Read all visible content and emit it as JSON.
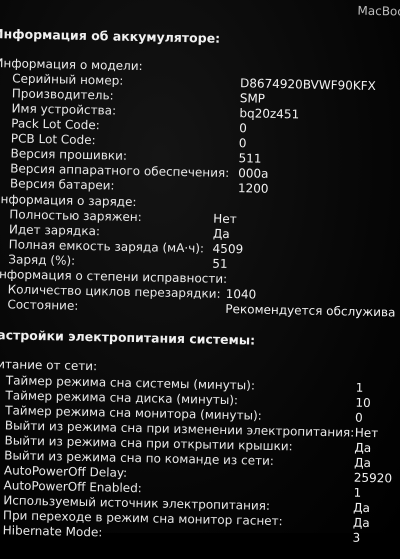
{
  "corner_text": "MacBook",
  "battery_section": {
    "title": "Информация об аккумуляторе:",
    "model_info": {
      "title": "Информация о модели:",
      "rows": [
        {
          "label": "Серийный номер:",
          "value": "D8674920BVWF90KFX"
        },
        {
          "label": "Производитель:",
          "value": "SMP"
        },
        {
          "label": "Имя устройства:",
          "value": "bq20z451"
        },
        {
          "label": "Pack Lot Code:",
          "value": "0"
        },
        {
          "label": "PCB Lot Code:",
          "value": "0"
        },
        {
          "label": "Версия прошивки:",
          "value": "511"
        },
        {
          "label": "Версия аппаратного обеспечения:",
          "value": "000a"
        },
        {
          "label": "Версия батареи:",
          "value": "1200"
        }
      ]
    },
    "charge_info": {
      "title": "Информация о заряде:",
      "rows": [
        {
          "label": "Полностью заряжен:",
          "value": "Нет"
        },
        {
          "label": "Идет зарядка:",
          "value": "Да"
        },
        {
          "label": "Полная емкость заряда (мА·ч):",
          "value": "4509"
        },
        {
          "label": "Заряд (%):",
          "value": "51"
        }
      ]
    },
    "health_info": {
      "title": "Информация о степени исправности:",
      "rows": [
        {
          "label": "Количество циклов перезарядки:",
          "value": "1040"
        },
        {
          "label": "Состояние:",
          "value": "Рекомендуется обслужива"
        }
      ]
    }
  },
  "power_section": {
    "title": "Настройки электропитания системы:",
    "ac_power": {
      "title": "Питание от сети:",
      "rows": [
        {
          "label": "Таймер режима сна системы (минуты):",
          "value": "1"
        },
        {
          "label": "Таймер режима сна диска (минуты):",
          "value": "10"
        },
        {
          "label": "Таймер режима сна монитора (минуты):",
          "value": "0"
        },
        {
          "label": "Выйти из режима сна при изменении электропитания:",
          "value": "Нет"
        },
        {
          "label": "Выйти из режима сна при открытии крышки:",
          "value": "Да"
        },
        {
          "label": "Выйти из режима сна по команде из сети:",
          "value": "Да"
        },
        {
          "label": "AutoPowerOff Delay:",
          "value": "25920"
        },
        {
          "label": "AutoPowerOff Enabled:",
          "value": "1"
        },
        {
          "label": "Используемый источник электропитания:",
          "value": "Да"
        },
        {
          "label": "При переходе в режим сна монитор гаснет:",
          "value": "Да"
        },
        {
          "label": "Hibernate Mode:",
          "value": "3"
        }
      ]
    }
  }
}
